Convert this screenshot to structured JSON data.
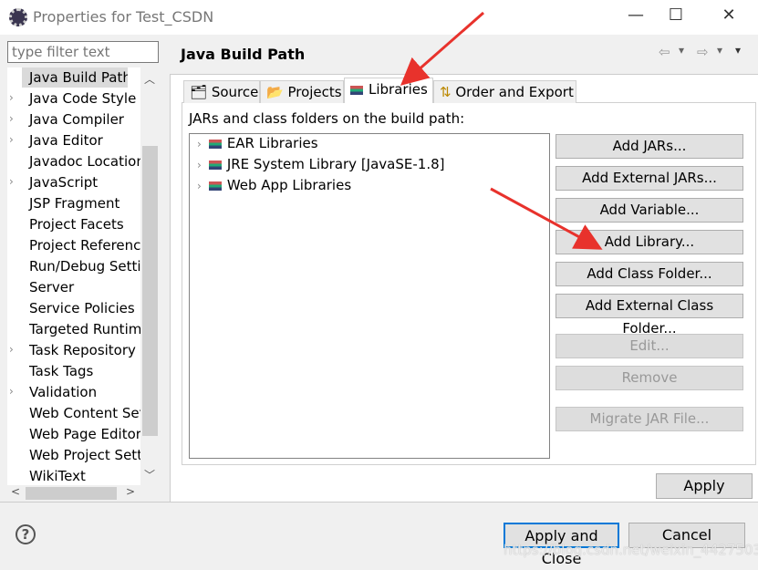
{
  "window": {
    "title": "Properties for Test_CSDN",
    "minimize": "—",
    "maximize": "☐",
    "close": "✕"
  },
  "filter": {
    "placeholder": "type filter text"
  },
  "sidebar": {
    "items": [
      {
        "label": "Java Build Path",
        "expandable": false,
        "selected": true
      },
      {
        "label": "Java Code Style",
        "expandable": true
      },
      {
        "label": "Java Compiler",
        "expandable": true
      },
      {
        "label": "Java Editor",
        "expandable": true
      },
      {
        "label": "Javadoc Location",
        "expandable": false
      },
      {
        "label": "JavaScript",
        "expandable": true
      },
      {
        "label": "JSP Fragment",
        "expandable": false
      },
      {
        "label": "Project Facets",
        "expandable": false
      },
      {
        "label": "Project References",
        "expandable": false
      },
      {
        "label": "Run/Debug Settings",
        "expandable": false
      },
      {
        "label": "Server",
        "expandable": false
      },
      {
        "label": "Service Policies",
        "expandable": false
      },
      {
        "label": "Targeted Runtimes",
        "expandable": false
      },
      {
        "label": "Task Repository",
        "expandable": true
      },
      {
        "label": "Task Tags",
        "expandable": false
      },
      {
        "label": "Validation",
        "expandable": true
      },
      {
        "label": "Web Content Settings",
        "expandable": false
      },
      {
        "label": "Web Page Editor",
        "expandable": false
      },
      {
        "label": "Web Project Settings",
        "expandable": false
      },
      {
        "label": "WikiText",
        "expandable": false
      }
    ]
  },
  "page": {
    "title": "Java Build Path",
    "nav": {
      "back": "⇦",
      "forward": "⇨",
      "menu": "▾"
    }
  },
  "tabs": [
    {
      "label": "Source"
    },
    {
      "label": "Projects"
    },
    {
      "label": "Libraries",
      "active": true
    },
    {
      "label": "Order and Export"
    }
  ],
  "libraries": {
    "caption": "JARs and class folders on the build path:",
    "tree": [
      "EAR Libraries",
      "JRE System Library [JavaSE-1.8]",
      "Web App Libraries"
    ],
    "buttons": [
      {
        "label": "Add JARs...",
        "enabled": true
      },
      {
        "label": "Add External JARs...",
        "enabled": true
      },
      {
        "label": "Add Variable...",
        "enabled": true
      },
      {
        "label": "Add Library...",
        "enabled": true
      },
      {
        "label": "Add Class Folder...",
        "enabled": true
      },
      {
        "label": "Add External Class Folder...",
        "enabled": true
      },
      {
        "label": "Edit...",
        "enabled": false
      },
      {
        "label": "Remove",
        "enabled": false
      },
      {
        "label": "Migrate JAR File...",
        "enabled": false
      }
    ]
  },
  "apply_label": "Apply",
  "footer": {
    "help": "?",
    "apply_close": "Apply and Close",
    "cancel": "Cancel",
    "watermark": "https://blog.csdn.net/weixin_44275036"
  },
  "colors": {
    "annotation_arrow": "#e8322c",
    "focus_border": "#0078d7"
  }
}
